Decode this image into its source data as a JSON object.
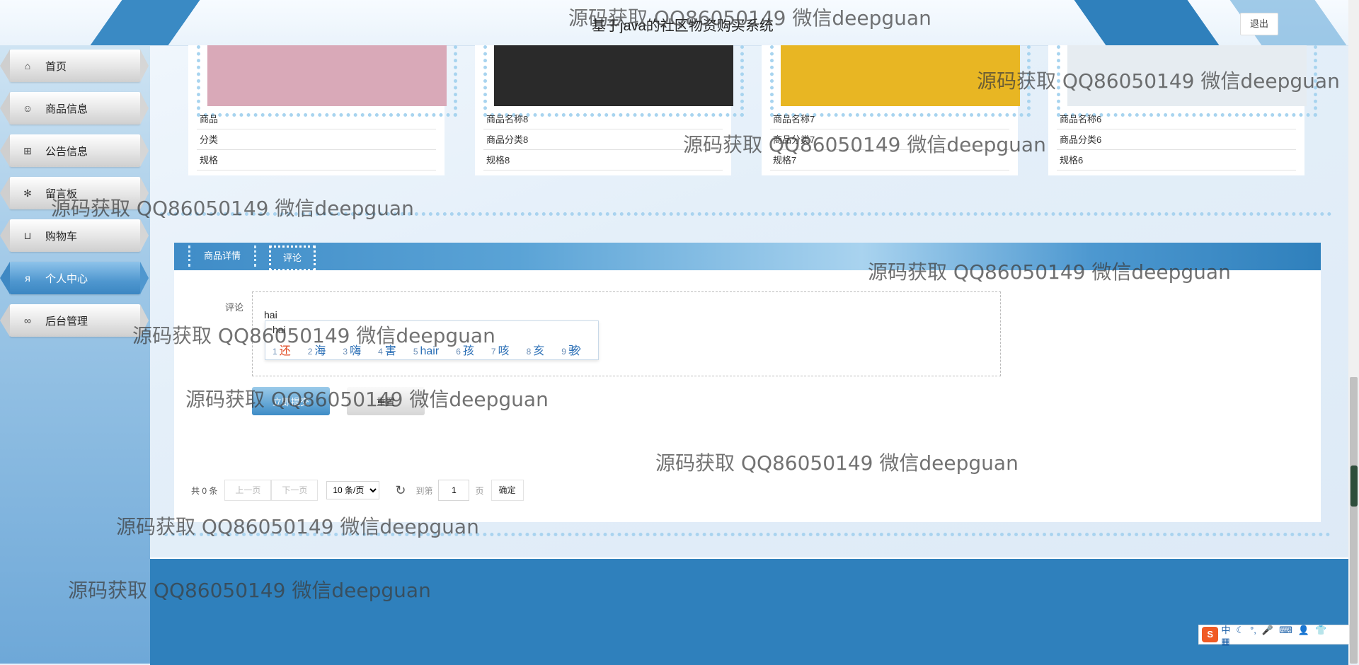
{
  "header": {
    "title": "基于java的社区物资购买系统",
    "logout_label": "退出"
  },
  "sidebar": {
    "items": [
      {
        "label": "首页",
        "icon": "home-icon",
        "glyph": "⌂"
      },
      {
        "label": "商品信息",
        "icon": "smile-icon",
        "glyph": "☺"
      },
      {
        "label": "公告信息",
        "icon": "grid-icon",
        "glyph": "⊞"
      },
      {
        "label": "留言板",
        "icon": "gear-icon",
        "glyph": "✻"
      },
      {
        "label": "购物车",
        "icon": "cart-icon",
        "glyph": "⊔"
      },
      {
        "label": "个人中心",
        "icon": "user-icon",
        "glyph": "ᴙ"
      },
      {
        "label": "后台管理",
        "icon": "link-icon",
        "glyph": "∞"
      }
    ],
    "active_index": 5
  },
  "products": [
    {
      "name": "商品",
      "category": "分类",
      "spec": "规格",
      "image_color": "#d9a9b8"
    },
    {
      "name": "商品名称8",
      "category": "商品分类8",
      "spec": "规格8",
      "image_color": "#2a2a2a"
    },
    {
      "name": "商品名称7",
      "category": "商品分类7",
      "spec": "规格7",
      "image_color": "#e8b623"
    },
    {
      "name": "商品名称6",
      "category": "商品分类6",
      "spec": "规格6",
      "image_color": "#e6ecf1"
    }
  ],
  "detail": {
    "tabs": [
      "商品详情",
      "评论"
    ],
    "active_tab": 1,
    "comment_label": "评论",
    "comment_value": "hai",
    "submit_label": "立即提交",
    "reset_label": "重置"
  },
  "ime": {
    "pinyin": "hai",
    "candidates": [
      {
        "num": "1",
        "text": "还"
      },
      {
        "num": "2",
        "text": "海"
      },
      {
        "num": "3",
        "text": "嗨"
      },
      {
        "num": "4",
        "text": "害"
      },
      {
        "num": "5",
        "text": "hair"
      },
      {
        "num": "6",
        "text": "孩"
      },
      {
        "num": "7",
        "text": "咳"
      },
      {
        "num": "8",
        "text": "亥"
      },
      {
        "num": "9",
        "text": "骇"
      }
    ],
    "nav": "‹ ›",
    "status": [
      "中",
      "☾",
      "°,",
      "🎤",
      "⌨",
      "👤",
      "👕",
      "▦"
    ]
  },
  "pager": {
    "total": "共 0 条",
    "prev": "上一页",
    "next": "下一页",
    "page_size": "10 条/页",
    "goto": "到第",
    "page_value": "1",
    "page_unit": "页",
    "confirm": "确定"
  },
  "watermark": "源码获取 QQ86050149 微信deepguan"
}
